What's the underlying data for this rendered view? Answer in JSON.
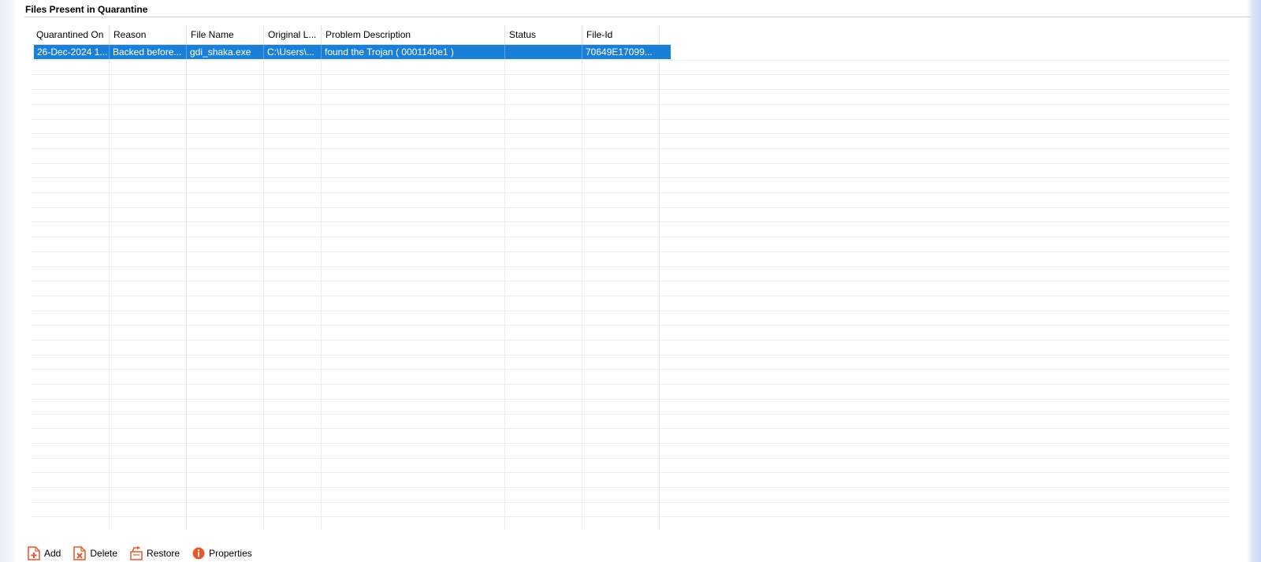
{
  "section": {
    "title": "Files Present in Quarantine"
  },
  "table": {
    "columns": [
      "Quarantined On",
      "Reason",
      "File Name",
      "Original L...",
      "Problem Description",
      "Status",
      "File-Id"
    ],
    "rows": [
      [
        "26-Dec-2024 1...",
        "Backed before...",
        "gdi_shaka.exe",
        "C:\\Users\\...",
        "found the Trojan ( 0001140e1 )",
        "",
        "70649E17099..."
      ]
    ]
  },
  "toolbar": {
    "add_label": "Add",
    "delete_label": "Delete",
    "restore_label": "Restore",
    "properties_label": "Properties"
  },
  "icons": {
    "add": "add-file-icon",
    "delete": "delete-file-icon",
    "restore": "restore-icon",
    "properties": "info-icon"
  },
  "colors": {
    "selection": "#1a7fd6",
    "icon_accent": "#e8562a"
  }
}
